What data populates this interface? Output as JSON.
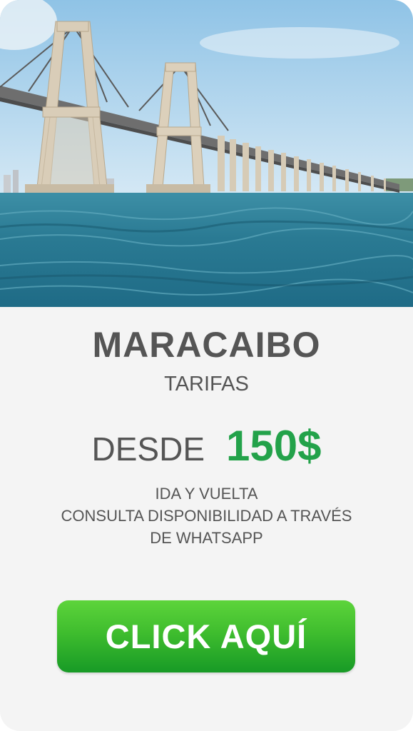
{
  "hero": {
    "image_label": "bridge-over-lake-photo"
  },
  "title": "MARACAIBO",
  "subtitle": "TARIFAS",
  "price": {
    "prefix": "DESDE",
    "amount": "150$"
  },
  "info_lines": [
    "IDA Y VUELTA",
    "CONSULTA DISPONIBILIDAD A TRAVÉS",
    "DE WHATSAPP"
  ],
  "cta": {
    "label": "CLICK AQUÍ"
  },
  "colors": {
    "accent_green": "#23a24a",
    "text_gray": "#555555",
    "card_bg": "#f4f4f4"
  }
}
